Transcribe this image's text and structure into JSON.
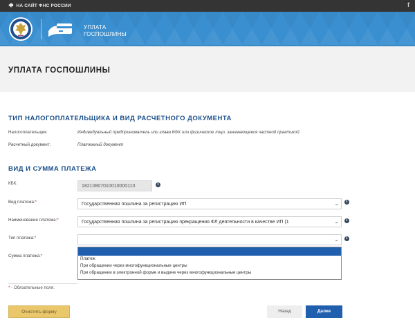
{
  "topbar": {
    "back_label": "НА САЙТ ФНС РОССИИ",
    "social_label": "f"
  },
  "banner": {
    "service_line1": "УПЛАТА",
    "service_line2": "ГОСПОШЛИНЫ"
  },
  "page": {
    "title": "УПЛАТА ГОСПОШЛИНЫ"
  },
  "section1": {
    "title": "ТИП НАЛОГОПЛАТЕЛЬЩИКА И ВИД РАСЧЕТНОГО ДОКУМЕНТА",
    "taxpayer_label": "Налогоплательщик:",
    "taxpayer_value": "Индивидуальный предприниматель или глава КФХ или физическое лицо, занимающееся частной практикой",
    "document_label": "Расчетный документ:",
    "document_value": "Платежный документ"
  },
  "section2": {
    "title": "ВИД И СУММА ПЛАТЕЖА",
    "kbk_label": "КБК:",
    "kbk_value": "18210807010010000110",
    "payment_kind_label": "Вид платежа:",
    "payment_kind_value": "Государственная пошлина за регистрацию ИП",
    "payment_name_label": "Наименование платежа:",
    "payment_name_value": "Государственная пошлина за регистрацию прекращения ФЛ деятельности в качестве ИП (1",
    "payment_type_label": "Тип платежа:",
    "payment_type_value": "",
    "amount_label": "Сумма платежа:",
    "required_mark": "*",
    "payment_type_options": [
      "",
      "Платеж",
      "При обращении через многофункциональные центры",
      "При обращении в электронной форме и выдаче через многофункциональные центры"
    ]
  },
  "footer": {
    "required_note_star": "*",
    "required_note": " - Обязательные поля.",
    "clear_label": "Очистить форму",
    "back_label": "Назад",
    "next_label": "Далее"
  },
  "colors": {
    "banner": "#3a8fd0",
    "section_title": "#1a4f8a",
    "primary_button": "#1f5fae",
    "clear_button": "#e9c76a"
  }
}
